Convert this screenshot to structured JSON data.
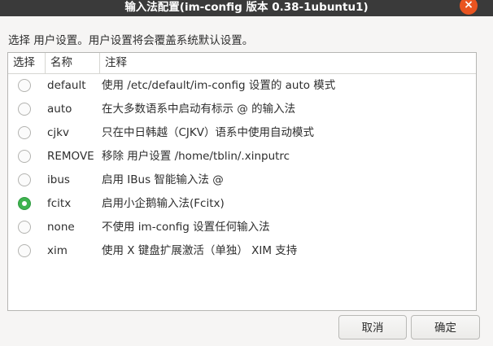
{
  "window": {
    "title": "输入法配置(im-config 版本 0.38-1ubuntu1)",
    "close_icon": "×"
  },
  "description": "选择 用户设置。用户设置将会覆盖系统默认设置。",
  "table": {
    "columns": [
      "选择",
      "名称",
      "注释"
    ],
    "rows": [
      {
        "name": "default",
        "comment": "使用 /etc/default/im-config 设置的 auto 模式",
        "selected": false
      },
      {
        "name": "auto",
        "comment": "在大多数语系中启动有标示 @ 的输入法",
        "selected": false
      },
      {
        "name": "cjkv",
        "comment": "只在中日韩越（CJKV）语系中使用自动模式",
        "selected": false
      },
      {
        "name": "REMOVE",
        "comment": "移除 用户设置 /home/tblin/.xinputrc",
        "selected": false
      },
      {
        "name": "ibus",
        "comment": "启用 IBus 智能输入法 @",
        "selected": false
      },
      {
        "name": "fcitx",
        "comment": "启用小企鹅输入法(Fcitx)",
        "selected": true
      },
      {
        "name": "none",
        "comment": "不使用 im-config 设置任何输入法",
        "selected": false
      },
      {
        "name": "xim",
        "comment": "使用 X 键盘扩展激活（单独） XIM 支持",
        "selected": false
      }
    ]
  },
  "buttons": {
    "cancel": "取消",
    "ok": "确定"
  },
  "colors": {
    "titlebar": "#3a3a3a",
    "close_button": "#e95420",
    "radio_selected": "#3eb34f"
  }
}
